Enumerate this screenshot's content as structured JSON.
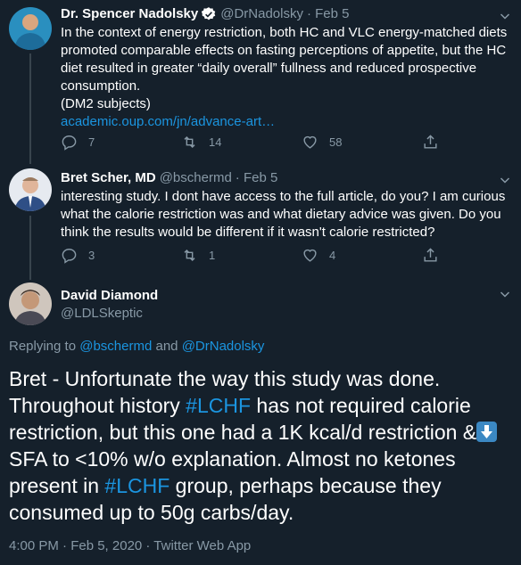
{
  "tweets": [
    {
      "name": "Dr. Spencer Nadolsky",
      "handle": "@DrNadolsky",
      "date": "· Feb 5",
      "verified": true,
      "text": "In the context of energy restriction, both HC and VLC energy-matched diets promoted comparable effects on fasting perceptions of appetite, but the HC diet resulted in greater “daily overall” fullness and reduced prospective consumption.",
      "text2": "(DM2 subjects)",
      "link": "academic.oup.com/jn/advance-art…",
      "replies": "7",
      "retweets": "14",
      "likes": "58"
    },
    {
      "name": "Bret Scher, MD",
      "handle": "@bschermd",
      "date": "· Feb 5",
      "text": "interesting study. I dont have access to the full article, do you? I am curious what the calorie restriction was and what dietary advice was given. Do you think the results would be different if it wasn't calorie restricted?",
      "replies": "3",
      "retweets": "1",
      "likes": "4"
    }
  ],
  "main": {
    "name": "David Diamond",
    "handle": "@LDLSkeptic",
    "replying_prefix": "Replying to",
    "reply_user1": "@bschermd",
    "reply_and": "and",
    "reply_user2": "@DrNadolsky",
    "text_a": "Bret - Unfortunate the way this study was done. Throughout history ",
    "hashtag1": "#LCHF",
    "text_b": " has not required calorie restriction, but this one had a 1K kcal/d restriction &",
    "text_c": " SFA to <10% w/o explanation. Almost no ketones present in ",
    "hashtag2": "#LCHF",
    "text_d": " group, perhaps because they consumed up to 50g carbs/day.",
    "emoji": "down-arrow-emoji",
    "timestamp": "4:00 PM · Feb 5, 2020 · Twitter Web App"
  },
  "colors": {
    "background": "#15202b",
    "secondary_text": "#8899a6",
    "link": "#1b95e0",
    "divider": "#38444d"
  }
}
